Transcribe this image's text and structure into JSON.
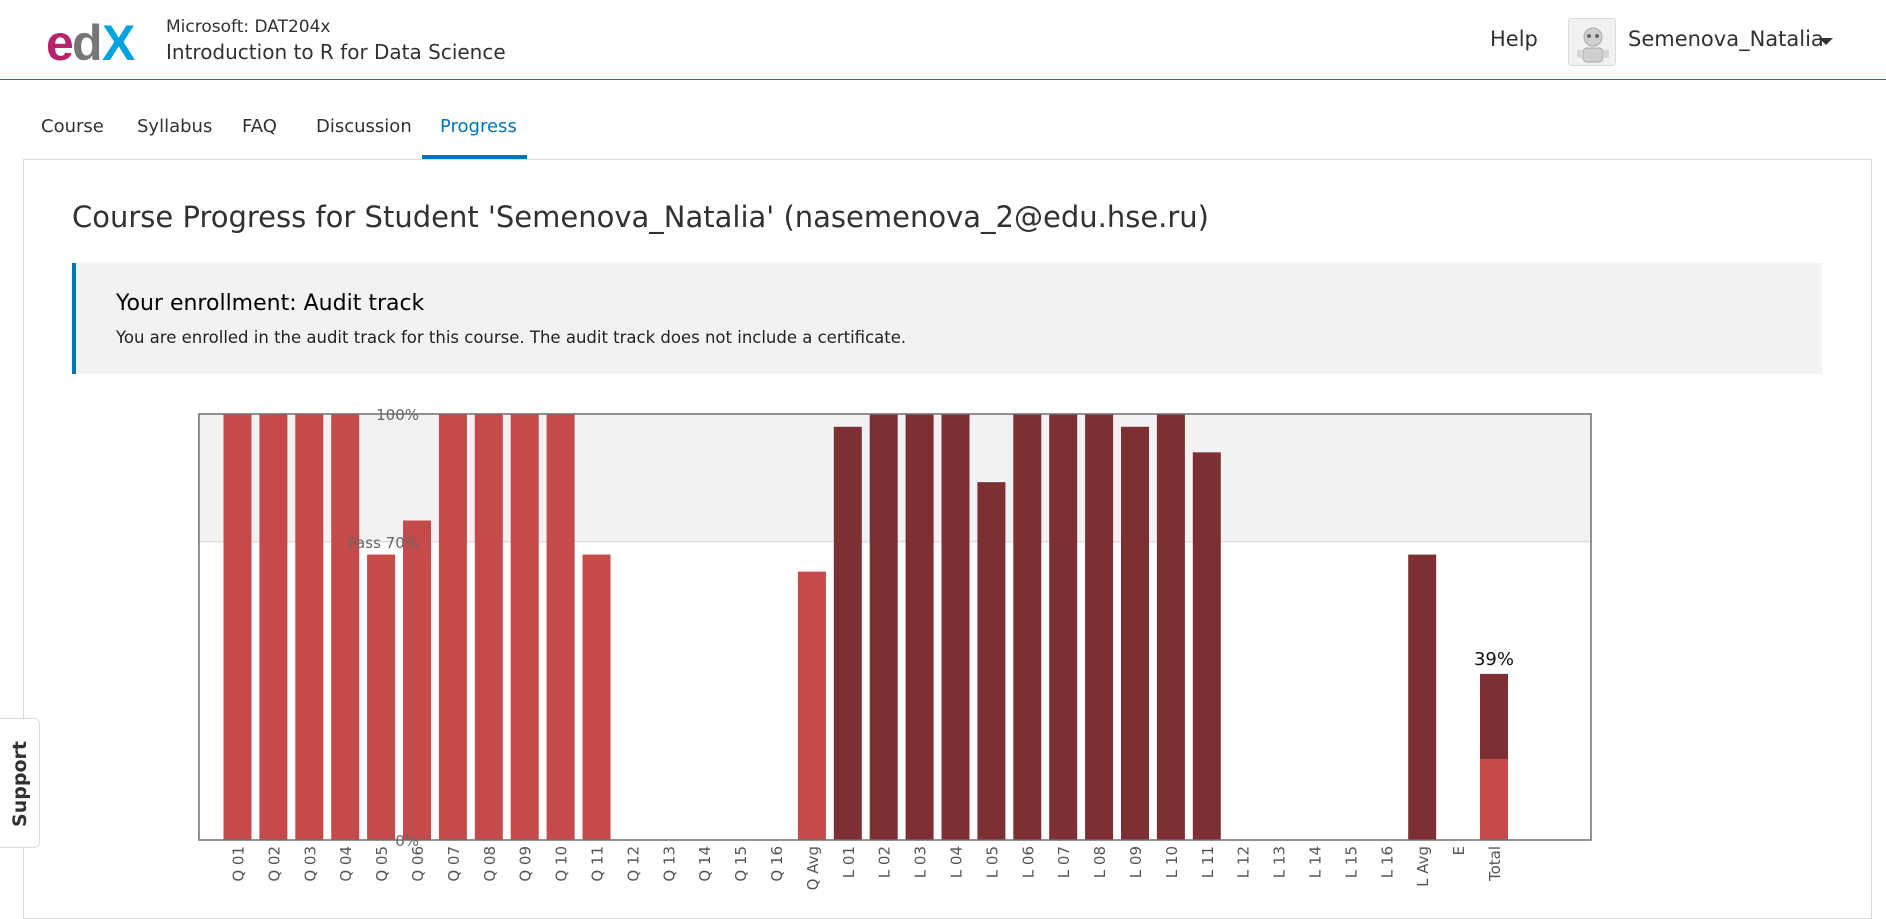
{
  "header": {
    "course_org": "Microsoft: DAT204x",
    "course_name": "Introduction to R for Data Science",
    "help_label": "Help",
    "username": "Semenova_Natalia",
    "icons": {
      "logo": "edx-logo",
      "avatar": "user-avatar-icon",
      "dropdown": "caret-down-icon"
    }
  },
  "tabs": [
    {
      "label": "Course"
    },
    {
      "label": "Syllabus"
    },
    {
      "label": "FAQ"
    },
    {
      "label": "Discussion"
    },
    {
      "label": "Progress",
      "active": true
    }
  ],
  "page_title": "Course Progress for Student 'Semenova_Natalia' (nasemenova_2@edu.hse.ru)",
  "enrollment": {
    "title": "Your enrollment: Audit track",
    "text": "You are enrolled in the audit track for this course. The audit track does not include a certificate."
  },
  "support_label": "Support",
  "colors": {
    "accent": "#0075b4",
    "quiz_bar": "#c64a4a",
    "lab_bar": "#7d2f33",
    "pass_band": "#f2f2f2"
  },
  "chart_data": {
    "type": "bar",
    "ylim": [
      0,
      100
    ],
    "y_ticks": [
      {
        "label": "0%",
        "value": 0
      },
      {
        "label": "Pass 70%",
        "value": 70
      },
      {
        "label": "100%",
        "value": 100
      }
    ],
    "categories": [
      "Q 01",
      "Q 02",
      "Q 03",
      "Q 04",
      "Q 05",
      "Q 06",
      "Q 07",
      "Q 08",
      "Q 09",
      "Q 10",
      "Q 11",
      "Q 12",
      "Q 13",
      "Q 14",
      "Q 15",
      "Q 16",
      "Q Avg",
      "L 01",
      "L 02",
      "L 03",
      "L 04",
      "L 05",
      "L 06",
      "L 07",
      "L 08",
      "L 09",
      "L 10",
      "L 11",
      "L 12",
      "L 13",
      "L 14",
      "L 15",
      "L 16",
      "L Avg",
      "E",
      "Total"
    ],
    "series": [
      {
        "group": "quiz",
        "values": [
          100,
          100,
          100,
          100,
          67,
          75,
          100,
          100,
          100,
          100,
          67,
          0,
          0,
          0,
          0,
          0,
          63,
          0,
          0,
          0,
          0,
          0,
          0,
          0,
          0,
          0,
          0,
          0,
          0,
          0,
          0,
          0,
          0,
          0,
          0,
          19
        ]
      },
      {
        "group": "lab",
        "values": [
          0,
          0,
          0,
          0,
          0,
          0,
          0,
          0,
          0,
          0,
          0,
          0,
          0,
          0,
          0,
          0,
          0,
          97,
          100,
          100,
          100,
          84,
          100,
          100,
          100,
          97,
          100,
          91,
          0,
          0,
          0,
          0,
          0,
          67,
          0,
          20
        ]
      }
    ],
    "total_label": "39%"
  }
}
